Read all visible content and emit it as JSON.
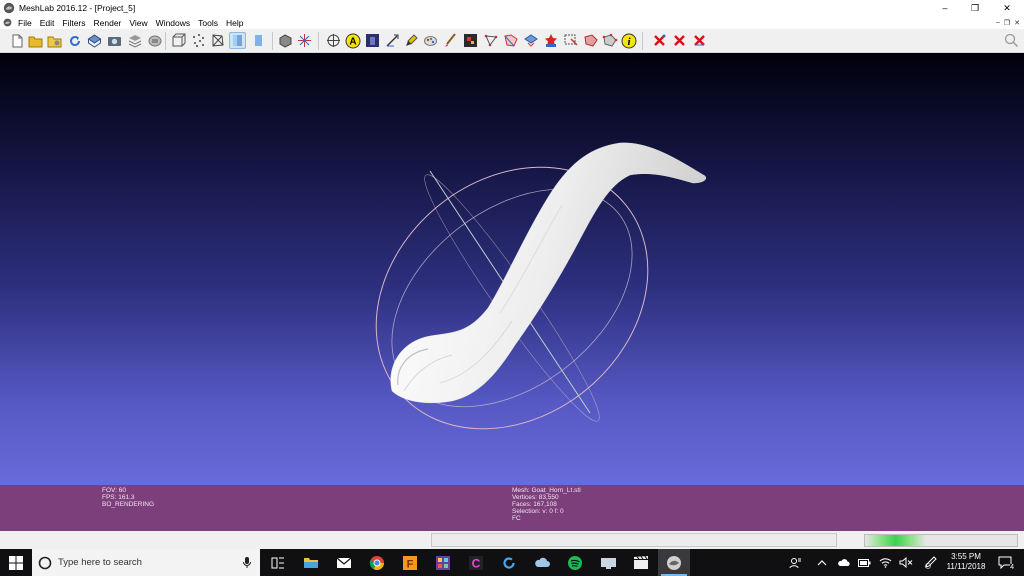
{
  "window": {
    "title": "MeshLab 2016.12 - [Project_5]",
    "minimize_glyph": "–",
    "restore_glyph": "❐",
    "close_glyph": "✕",
    "mdi_controls": [
      "–",
      "❐",
      "✕"
    ]
  },
  "menu": [
    "File",
    "Edit",
    "Filters",
    "Render",
    "View",
    "Windows",
    "Tools",
    "Help"
  ],
  "toolbar": {
    "icons": [
      "new-project-icon",
      "open-project-icon",
      "open-mesh-icon",
      "reload-icon",
      "save-mesh-icon",
      "snapshot-icon",
      "layers-icon",
      "console-icon",
      "bbox-icon",
      "points-icon",
      "wireframe-icon",
      "hidden-lines-icon",
      "flat-icon",
      "smooth-icon",
      "texture-icon",
      "select-faces-icon",
      "select-vertices-icon",
      "fit-icon",
      "annotation-icon",
      "draw-icon",
      "measure-icon",
      "align-icon",
      "paint-icon",
      "color-picker-icon",
      "pickpoints-icon",
      "select-connected-icon",
      "select-vertices-mode-icon",
      "georef-icon",
      "texture-param-icon",
      "manipulator-icon",
      "point-selector-icon",
      "info-icon",
      "delete-selected-faces-icon",
      "delete-selected-vertices-icon",
      "delete-all-icon",
      "search-icon"
    ],
    "annotation_letter": "A",
    "info_letter": "i"
  },
  "colors": {
    "info_bar_bg": "#7d3f7b",
    "mesh": "#f2f2f2",
    "trackball": "#d8b6c8",
    "taskbar": "#101013",
    "progress": "#3ccf4e"
  },
  "info": {
    "fov": "FOV: 60",
    "fps": "FPS:   161.3",
    "rendering": "BO_RENDERING",
    "mesh": "Mesh: Goat_Horn_Lt.stl",
    "vertices": "Vertices: 83,550",
    "faces": "Faces: 167,108",
    "selection": "Selection: v: 0 f: 0",
    "fc": "FC"
  },
  "taskbar": {
    "search_placeholder": "Type here to search",
    "apps": [
      {
        "name": "task-view-icon"
      },
      {
        "name": "file-explorer-icon"
      },
      {
        "name": "mail-icon"
      },
      {
        "name": "chrome-icon"
      },
      {
        "name": "f-app-icon",
        "letter": "F"
      },
      {
        "name": "photo-viewer-icon"
      },
      {
        "name": "c-app-icon",
        "letter": "C"
      },
      {
        "name": "reload-app-icon"
      },
      {
        "name": "cloud-app-icon"
      },
      {
        "name": "spotify-icon"
      },
      {
        "name": "desktop-app-icon"
      },
      {
        "name": "clapper-icon"
      },
      {
        "name": "meshlab-taskbar-icon",
        "active": true
      }
    ],
    "time": "3:55 PM",
    "date": "11/11/2018",
    "notification_count": "4"
  },
  "statusbar": {
    "progress_fraction": 0.4
  }
}
